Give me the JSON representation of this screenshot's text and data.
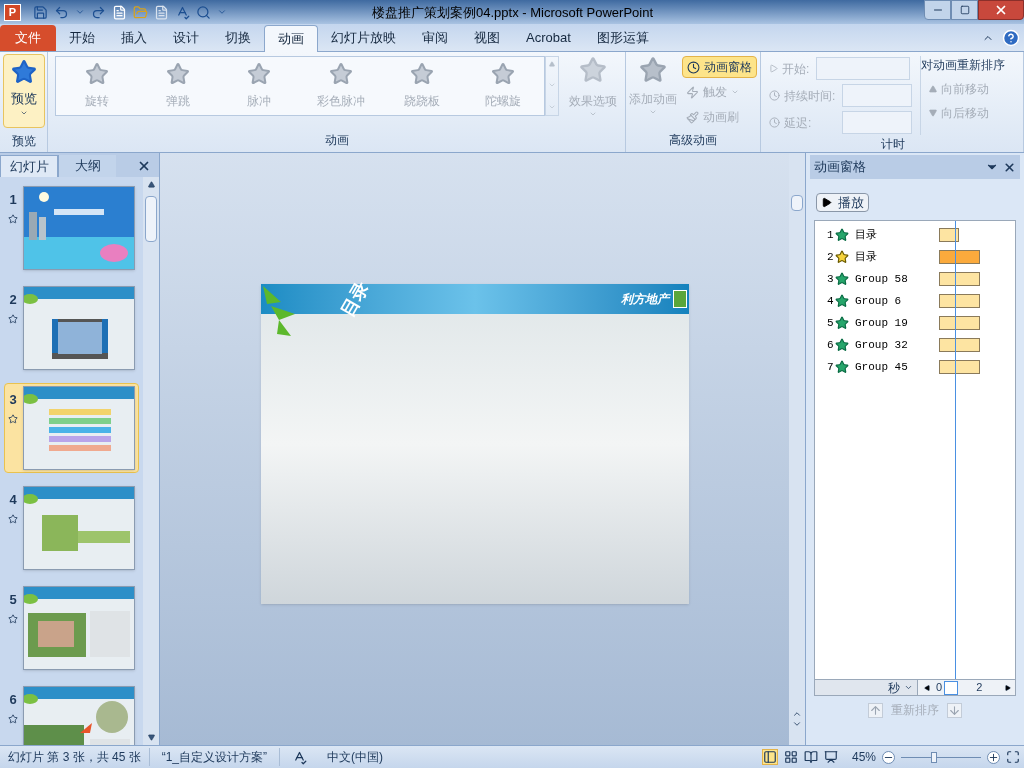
{
  "window": {
    "app_icon": "P",
    "title": "楼盘推广策划案例04.pptx - Microsoft PowerPoint"
  },
  "tabs": [
    {
      "label": "文件",
      "kind": "file",
      "selected": false
    },
    {
      "label": "开始",
      "kind": "tab",
      "selected": false
    },
    {
      "label": "插入",
      "kind": "tab",
      "selected": false
    },
    {
      "label": "设计",
      "kind": "tab",
      "selected": false
    },
    {
      "label": "切换",
      "kind": "tab",
      "selected": false
    },
    {
      "label": "动画",
      "kind": "tab",
      "selected": true
    },
    {
      "label": "幻灯片放映",
      "kind": "tab",
      "selected": false
    },
    {
      "label": "审阅",
      "kind": "tab",
      "selected": false
    },
    {
      "label": "视图",
      "kind": "tab",
      "selected": false
    },
    {
      "label": "Acrobat",
      "kind": "tab",
      "selected": false
    },
    {
      "label": "图形运算",
      "kind": "tab",
      "selected": false
    }
  ],
  "ribbon": {
    "preview": {
      "button": "预览",
      "group": "预览"
    },
    "animations": {
      "items": [
        "旋转",
        "弹跳",
        "脉冲",
        "彩色脉冲",
        "跷跷板",
        "陀螺旋"
      ],
      "effect_options": "效果选项",
      "group": "动画"
    },
    "advanced": {
      "add_animation": "添加动画",
      "animation_pane": {
        "label": "动画窗格",
        "selected": true
      },
      "trigger": "触发",
      "painter": "动画刷",
      "group": "高级动画"
    },
    "timing": {
      "start": "开始:",
      "duration": "持续时间:",
      "delay": "延迟:",
      "reorder_title": "对动画重新排序",
      "move_earlier": "向前移动",
      "move_later": "向后移动",
      "group": "计时"
    }
  },
  "slides_panel": {
    "tabs": [
      {
        "label": "幻灯片",
        "selected": true
      },
      {
        "label": "大纲",
        "selected": false
      }
    ],
    "thumbnails": [
      {
        "number": "1",
        "selected": false
      },
      {
        "number": "2",
        "selected": false
      },
      {
        "number": "3",
        "selected": true
      },
      {
        "number": "4",
        "selected": false
      },
      {
        "number": "5",
        "selected": false
      },
      {
        "number": "6",
        "selected": false
      }
    ]
  },
  "slide": {
    "title": "目录",
    "brand": "利方地产"
  },
  "animation_pane": {
    "title": "动画窗格",
    "play": "播放",
    "items": [
      {
        "number": "1",
        "name": "目录",
        "kind": "entrance",
        "bar": {
          "kind": "short"
        },
        "selected": false
      },
      {
        "number": "2",
        "name": "目录",
        "kind": "emphasis",
        "bar": {
          "kind": "long"
        },
        "selected": true
      },
      {
        "number": "3",
        "name": "Group 58",
        "kind": "entrance",
        "bar": {
          "kind": "long"
        },
        "selected": false
      },
      {
        "number": "4",
        "name": "Group 6",
        "kind": "entrance",
        "bar": {
          "kind": "long"
        },
        "selected": false
      },
      {
        "number": "5",
        "name": "Group 19",
        "kind": "entrance",
        "bar": {
          "kind": "long"
        },
        "selected": false
      },
      {
        "number": "6",
        "name": "Group 32",
        "kind": "entrance",
        "bar": {
          "kind": "long"
        },
        "selected": false
      },
      {
        "number": "7",
        "name": "Group 45",
        "kind": "entrance",
        "bar": {
          "kind": "long"
        },
        "selected": false
      }
    ],
    "unit": "秒",
    "ticks": [
      "0",
      "2"
    ],
    "reorder": "重新排序"
  },
  "status_bar": {
    "slide_info": "幻灯片 第 3 张，共 45 张",
    "theme": "“1_自定义设计方案”",
    "language": "中文(中国)",
    "zoom": "45%",
    "zoom_slider": {
      "level": 0.4
    }
  }
}
